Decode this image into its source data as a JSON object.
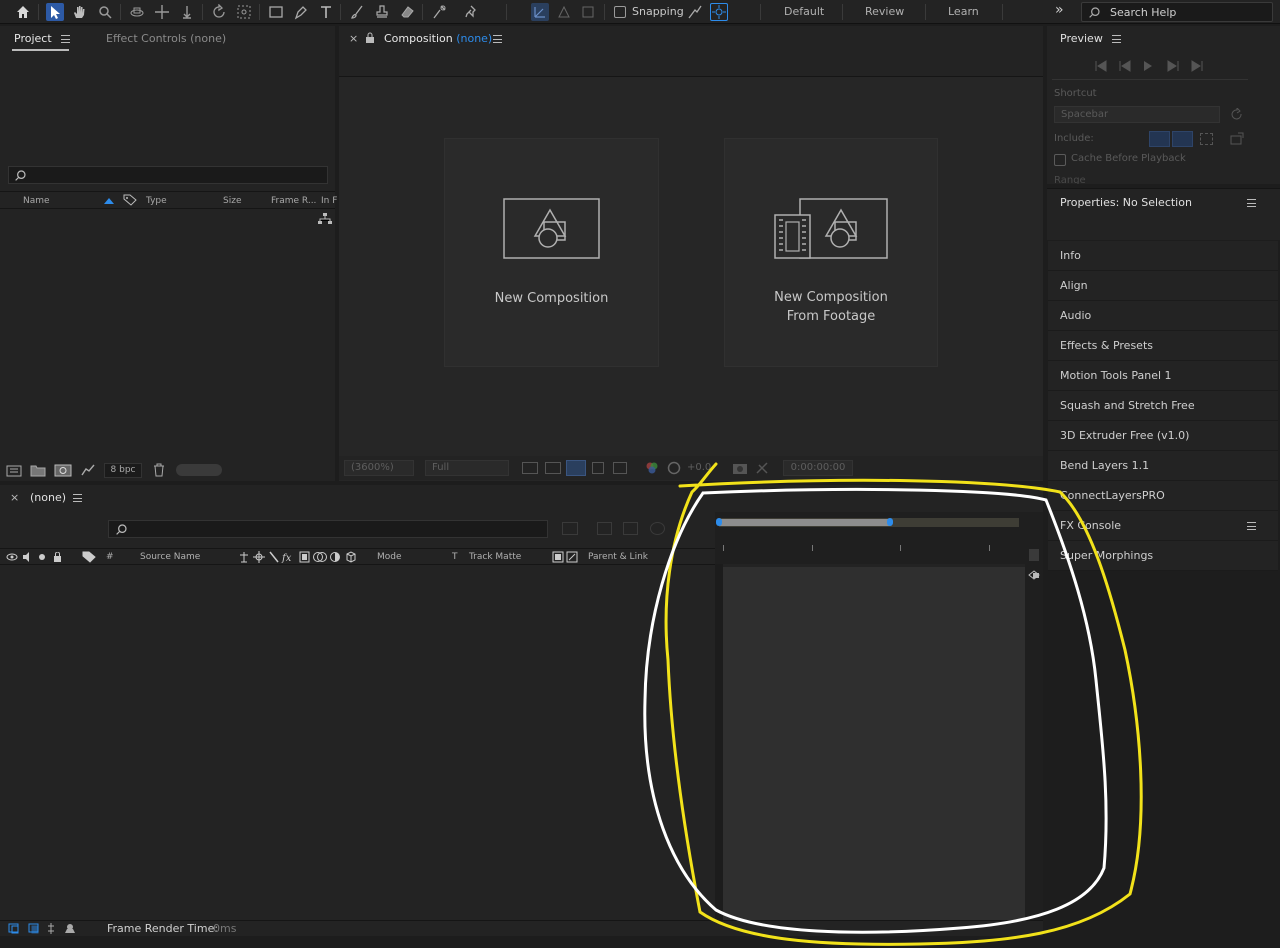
{
  "toolbar": {
    "snapping_label": "Snapping",
    "workspaces": [
      "Default",
      "Review",
      "Learn"
    ],
    "search_placeholder": "Search Help",
    "tools": [
      "home-icon",
      "selection-icon",
      "hand-icon",
      "zoom-icon",
      "orbit-icon",
      "pan-icon",
      "dolly-icon",
      "rotate-icon",
      "behind-icon",
      "rectangle-icon",
      "pen-icon",
      "type-icon",
      "brush-icon",
      "clone-stamp-icon",
      "eraser-icon",
      "roto-brush-icon",
      "puppet-icon"
    ]
  },
  "project_panel": {
    "tab_project": "Project",
    "tab_effect_controls": "Effect Controls (none)",
    "columns": [
      "Name",
      "Type",
      "Size",
      "Frame R...",
      "In F"
    ],
    "bpc_label": "8 bpc"
  },
  "composition_panel": {
    "tab_label": "Composition",
    "tab_suffix": "(none)",
    "card_new_composition": "New Composition",
    "card_from_footage_line1": "New Composition",
    "card_from_footage_line2": "From Footage",
    "zoom_value": "(3600%)",
    "resolution_value": "Full",
    "exposure_value": "+0.0",
    "timecode": "0:00:00:00"
  },
  "preview_panel": {
    "title": "Preview",
    "shortcut_label": "Shortcut",
    "shortcut_value": "Spacebar",
    "include_label": "Include:",
    "cache_label": "Cache Before Playback",
    "range_label": "Range"
  },
  "properties_panel": {
    "title": "Properties: No Selection",
    "items": [
      "Info",
      "Align",
      "Audio",
      "Effects & Presets",
      "Motion Tools Panel 1",
      "Squash and Stretch Free",
      "3D Extruder Free (v1.0)",
      "Bend Layers 1.1",
      "ConnectLayersPRO",
      "FX Console",
      "Super Morphings"
    ]
  },
  "timeline_panel": {
    "tab_label": "(none)",
    "columns": [
      "#",
      "Source Name",
      "Mode",
      "T",
      "Track Matte",
      "Parent & Link"
    ],
    "status_label": "Frame Render Time:",
    "status_value": "0ms"
  },
  "colors": {
    "accent_blue": "#2d8ceb",
    "annotation_yellow": "#f2e21a",
    "annotation_white": "#ffffff"
  }
}
